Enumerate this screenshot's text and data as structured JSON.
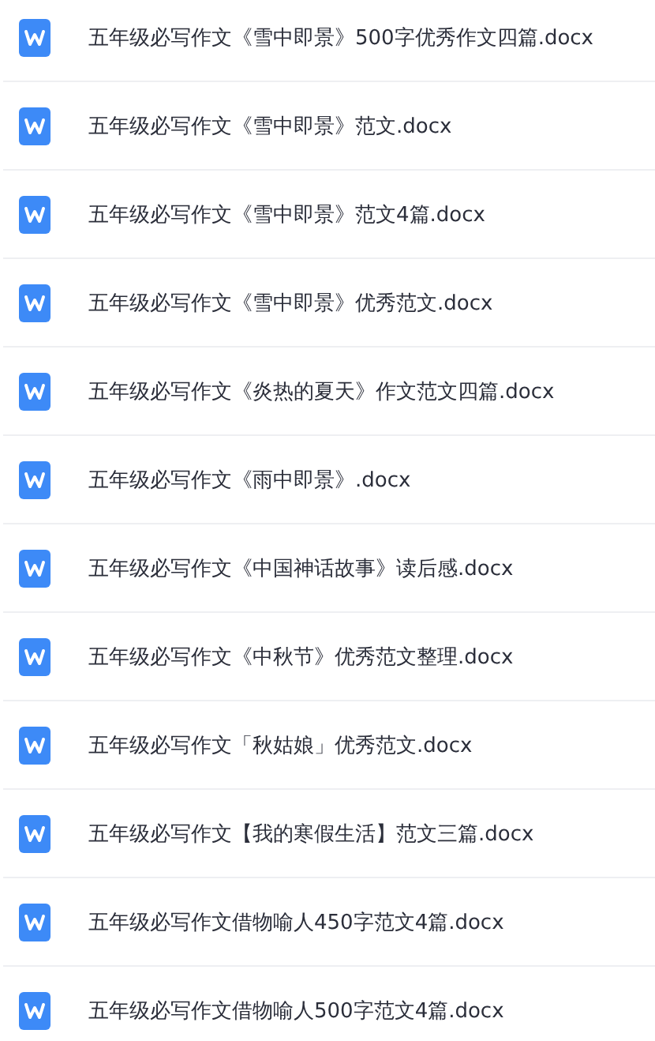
{
  "files": [
    {
      "name": "五年级必写作文《雪中即景》500字优秀作文四篇.docx"
    },
    {
      "name": "五年级必写作文《雪中即景》范文.docx"
    },
    {
      "name": "五年级必写作文《雪中即景》范文4篇.docx"
    },
    {
      "name": "五年级必写作文《雪中即景》优秀范文.docx"
    },
    {
      "name": "五年级必写作文《炎热的夏天》作文范文四篇.docx"
    },
    {
      "name": "五年级必写作文《雨中即景》.docx"
    },
    {
      "name": "五年级必写作文《中国神话故事》读后感.docx"
    },
    {
      "name": "五年级必写作文《中秋节》优秀范文整理.docx"
    },
    {
      "name": "五年级必写作文「秋姑娘」优秀范文.docx"
    },
    {
      "name": "五年级必写作文【我的寒假生活】范文三篇.docx"
    },
    {
      "name": "五年级必写作文借物喻人450字范文4篇.docx"
    },
    {
      "name": "五年级必写作文借物喻人500字范文4篇.docx"
    }
  ]
}
